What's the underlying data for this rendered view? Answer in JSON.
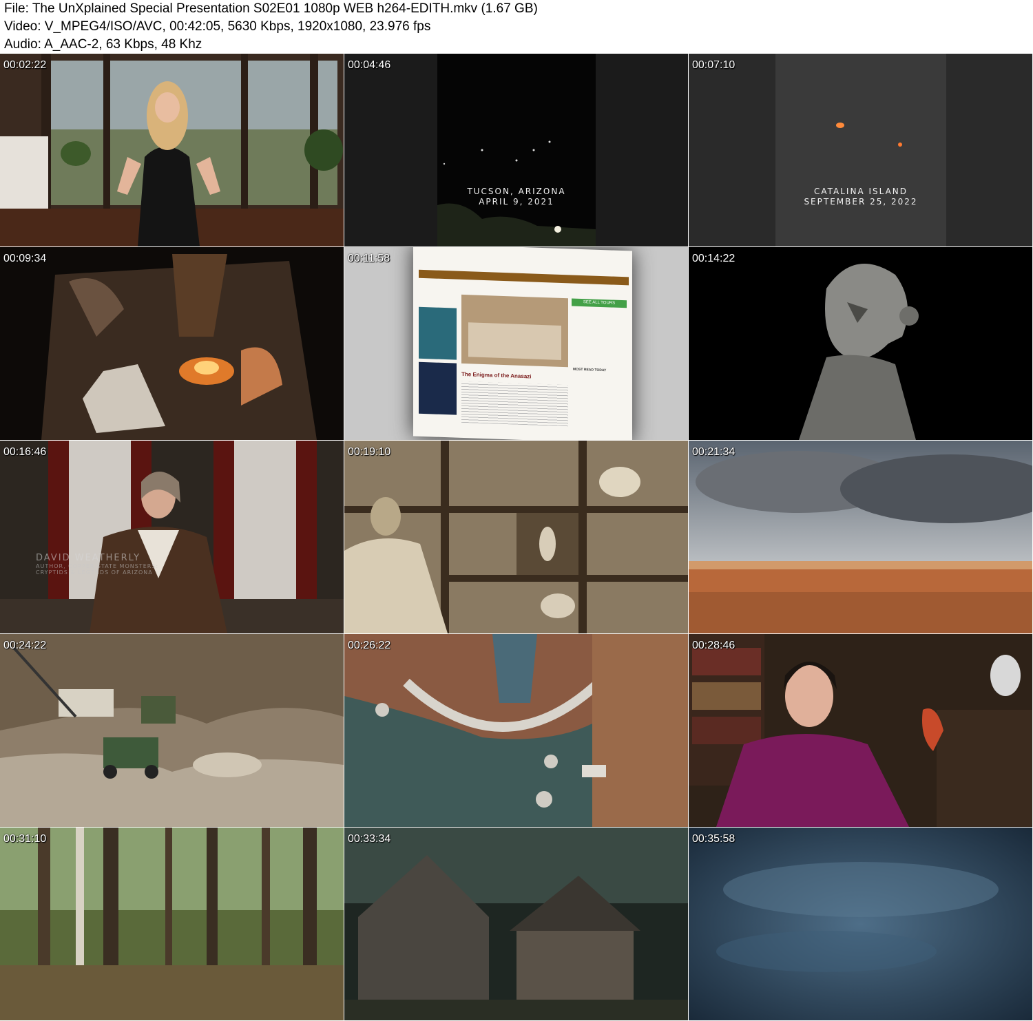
{
  "header": {
    "file_line": "File: The UnXplained Special Presentation S02E01 1080p WEB h264-EDITH.mkv (1.67 GB)",
    "video_line": "Video: V_MPEG4/ISO/AVC, 00:42:05, 5630 Kbps, 1920x1080, 23.976 fps",
    "audio_line": "Audio: A_AAC-2, 63 Kbps, 48 Khz"
  },
  "thumbnails": [
    {
      "timestamp": "00:02:22"
    },
    {
      "timestamp": "00:04:46",
      "caption_line1": "Tucson, Arizona",
      "caption_line2": "April 9, 2021"
    },
    {
      "timestamp": "00:07:10",
      "caption_line1": "Catalina Island",
      "caption_line2": "September 25, 2022"
    },
    {
      "timestamp": "00:09:34"
    },
    {
      "timestamp": "00:11:58",
      "web_headline": "The Enigma of the Anasazi",
      "web_button": "SEE ALL TOURS",
      "web_sidebar_title": "MOST READ TODAY"
    },
    {
      "timestamp": "00:14:22"
    },
    {
      "timestamp": "00:16:46",
      "name": "David Weatherly",
      "title_line1": "Author, Copper State Monsters:",
      "title_line2": "Cryptids & Legends of Arizona"
    },
    {
      "timestamp": "00:19:10"
    },
    {
      "timestamp": "00:21:34"
    },
    {
      "timestamp": "00:24:22"
    },
    {
      "timestamp": "00:26:22"
    },
    {
      "timestamp": "00:28:46"
    },
    {
      "timestamp": "00:31:10"
    },
    {
      "timestamp": "00:33:34"
    },
    {
      "timestamp": "00:35:58"
    }
  ]
}
